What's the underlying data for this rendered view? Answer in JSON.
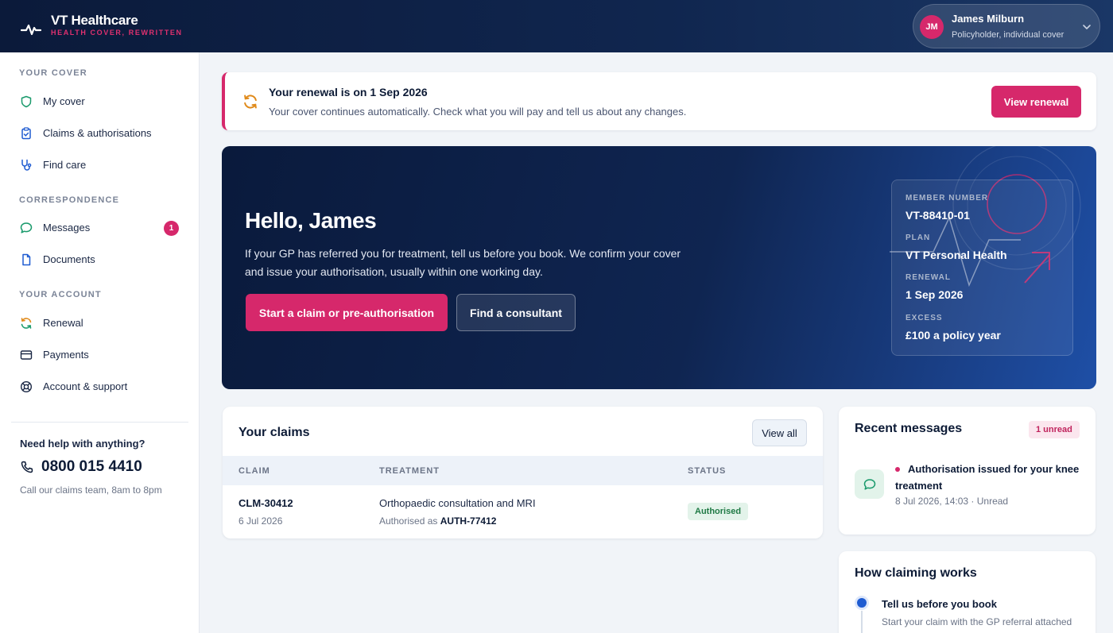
{
  "brand": {
    "name": "VT Healthcare",
    "tagline": "HEALTH COVER, REWRITTEN"
  },
  "user": {
    "initials": "JM",
    "name": "James Milburn",
    "role": "Policyholder, individual cover"
  },
  "sidebar": {
    "sections": [
      {
        "title": "YOUR COVER",
        "items": [
          {
            "label": "My cover",
            "icon": "shield-icon"
          },
          {
            "label": "Claims & authorisations",
            "icon": "clipboard-check-icon"
          },
          {
            "label": "Find care",
            "icon": "stethoscope-icon"
          }
        ]
      },
      {
        "title": "CORRESPONDENCE",
        "items": [
          {
            "label": "Messages",
            "icon": "chat-bubble-icon",
            "badge": "1"
          },
          {
            "label": "Documents",
            "icon": "document-icon"
          }
        ]
      },
      {
        "title": "YOUR ACCOUNT",
        "items": [
          {
            "label": "Renewal",
            "icon": "refresh-icon"
          },
          {
            "label": "Payments",
            "icon": "credit-card-icon"
          },
          {
            "label": "Account & support",
            "icon": "lifebuoy-icon"
          }
        ]
      }
    ],
    "help": {
      "title": "Need help with anything?",
      "phone": "0800 015 4410",
      "hours": "Call our claims team, 8am to 8pm"
    }
  },
  "renewal": {
    "title": "Your renewal is on 1 Sep 2026",
    "subtitle": "Your cover continues automatically. Check what you will pay and tell us about any changes.",
    "button": "View renewal"
  },
  "hero": {
    "greeting": "Hello, James",
    "text": "If your GP has referred you for treatment, tell us before you book. We confirm your cover and issue your authorisation, usually within one working day.",
    "primary_button": "Start a claim or pre-authorisation",
    "secondary_button": "Find a consultant",
    "member": {
      "number_label": "MEMBER NUMBER",
      "number": "VT-88410-01",
      "plan_label": "PLAN",
      "plan": "VT Personal Health",
      "renewal_label": "RENEWAL",
      "renewal": "1 Sep 2026",
      "excess_label": "EXCESS",
      "excess": "£100 a policy year"
    }
  },
  "claims": {
    "title": "Your claims",
    "view_all": "View all",
    "columns": [
      "CLAIM",
      "TREATMENT",
      "STATUS"
    ],
    "rows": [
      {
        "id": "CLM-30412",
        "date": "6 Jul 2026",
        "treatment": "Orthopaedic consultation and MRI",
        "auth_prefix": "Authorised as",
        "auth_code": "AUTH-77412",
        "status": "Authorised"
      }
    ]
  },
  "messages": {
    "title": "Recent messages",
    "unread": "1 unread",
    "items": [
      {
        "subject": "Authorisation issued for your knee treatment",
        "meta": "8 Jul 2026, 14:03 · Unread"
      }
    ]
  },
  "how": {
    "title": "How claiming works",
    "steps": [
      {
        "title": "Tell us before you book",
        "subtitle": "Start your claim with the GP referral attached"
      }
    ]
  },
  "colors": {
    "accent": "#d6286b",
    "navy": "#0b1a3a",
    "success": "#1f7a45",
    "step": "#1e5bd1"
  }
}
